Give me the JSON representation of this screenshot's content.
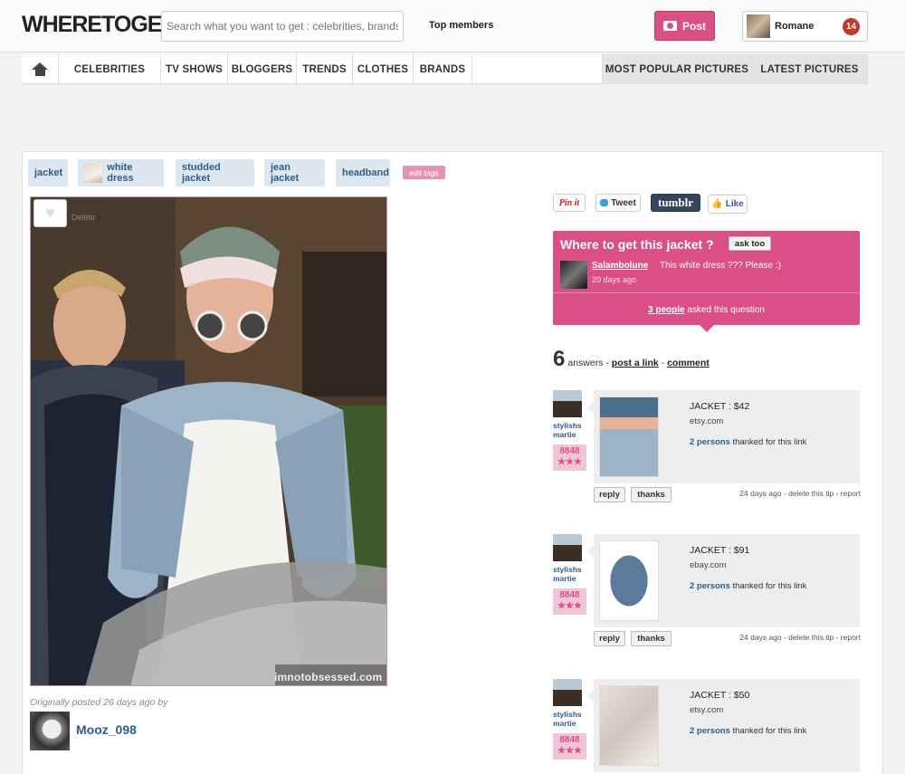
{
  "header": {
    "logo": "WHERETOGET",
    "search_placeholder": "Search what you want to get : celebrities, brands,",
    "top_members": "Top members",
    "post_label": "Post",
    "user_name": "Romane",
    "notification_count": "14"
  },
  "nav": {
    "items": [
      "CELEBRITIES",
      "TV SHOWS",
      "BLOGGERS",
      "TRENDS",
      "CLOTHES",
      "BRANDS"
    ],
    "right": [
      "MOST POPULAR PICTURES",
      "LATEST PICTURES"
    ]
  },
  "tags": {
    "items": [
      "jacket",
      "white dress",
      "studded jacket",
      "jean jacket",
      "headband"
    ],
    "edit": "edit tags"
  },
  "photo": {
    "delete_label": "Delete",
    "watermark": "imnotobsessed.com"
  },
  "poster": {
    "caption": "Originally posted 26 days ago by",
    "name": "Mooz_098"
  },
  "share": {
    "pinit": "Pin it",
    "tweet": "Tweet",
    "tumblr": "tumblr",
    "like": "Like"
  },
  "ask": {
    "title": "Where to get this jacket ?",
    "ask_too": "ask too",
    "user": "Salambolune",
    "question": "This white dress ??? Please :)",
    "time": "20 days ago",
    "people_link": "3 people",
    "people_text": " asked this question"
  },
  "answers": {
    "count": "6",
    "label": "answers - ",
    "post_link": "post a link",
    "sep": " - ",
    "comment": "comment",
    "items": [
      {
        "user": "stylishs martie",
        "points": "8848",
        "stars": "★★★",
        "price": "JACKET : $42",
        "site": "etsy.com",
        "thanks_count": "2 persons",
        "thanks_text": " thanked for this link",
        "reply": "reply",
        "thanks": "thanks",
        "meta": "24 days ago - delete this tip - report"
      },
      {
        "user": "stylishs martie",
        "points": "8848",
        "stars": "★★★",
        "price": "JACKET : $91",
        "site": "ebay.com",
        "thanks_count": "2 persons",
        "thanks_text": " thanked for this link",
        "reply": "reply",
        "thanks": "thanks",
        "meta": "24 days ago - delete this tip - report"
      },
      {
        "user": "stylishs martie",
        "points": "8848",
        "stars": "★★★",
        "price": "JACKET : $50",
        "site": "etsy.com",
        "thanks_count": "2 persons",
        "thanks_text": " thanked for this link",
        "reply": "reply",
        "thanks": "thanks",
        "meta": "24 days ago - delete this tip - report"
      }
    ]
  },
  "colors": {
    "brand_pink": "#d94f86",
    "link_blue": "#2f5d8a",
    "tag_bg": "#dde7f0"
  }
}
